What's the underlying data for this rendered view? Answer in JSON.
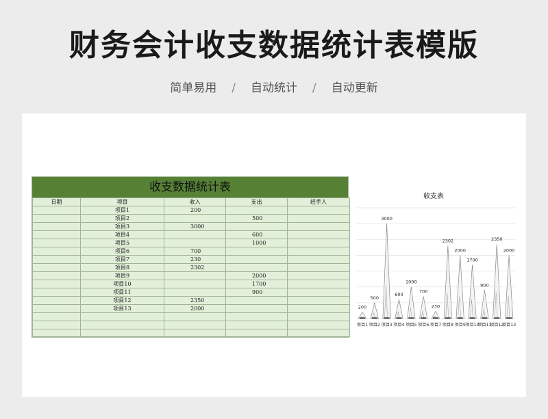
{
  "header": {
    "title": "财务会计收支数据统计表模版",
    "tags": [
      "简单易用",
      "自动统计",
      "自动更新"
    ],
    "separator": "/"
  },
  "sheet": {
    "title": "收支数据统计表",
    "columns": [
      "日期",
      "项目",
      "收入",
      "支出",
      "经手人"
    ],
    "rows": [
      {
        "date": "",
        "item": "项目1",
        "income": "200",
        "expense": "",
        "handler": ""
      },
      {
        "date": "",
        "item": "项目2",
        "income": "",
        "expense": "500",
        "handler": ""
      },
      {
        "date": "",
        "item": "项目3",
        "income": "3000",
        "expense": "",
        "handler": ""
      },
      {
        "date": "",
        "item": "项目4",
        "income": "",
        "expense": "600",
        "handler": ""
      },
      {
        "date": "",
        "item": "项目5",
        "income": "",
        "expense": "1000",
        "handler": ""
      },
      {
        "date": "",
        "item": "项目6",
        "income": "700",
        "expense": "",
        "handler": ""
      },
      {
        "date": "",
        "item": "项目7",
        "income": "230",
        "expense": "",
        "handler": ""
      },
      {
        "date": "",
        "item": "项目8",
        "income": "2302",
        "expense": "",
        "handler": ""
      },
      {
        "date": "",
        "item": "项目9",
        "income": "",
        "expense": "2000",
        "handler": ""
      },
      {
        "date": "",
        "item": "项目10",
        "income": "",
        "expense": "1700",
        "handler": ""
      },
      {
        "date": "",
        "item": "项目11",
        "income": "",
        "expense": "900",
        "handler": ""
      },
      {
        "date": "",
        "item": "项目12",
        "income": "2350",
        "expense": "",
        "handler": ""
      },
      {
        "date": "",
        "item": "项目13",
        "income": "2000",
        "expense": "",
        "handler": ""
      },
      {
        "date": "",
        "item": "",
        "income": "",
        "expense": "",
        "handler": ""
      },
      {
        "date": "",
        "item": "",
        "income": "",
        "expense": "",
        "handler": ""
      },
      {
        "date": "",
        "item": "",
        "income": "",
        "expense": "",
        "handler": ""
      }
    ],
    "colors": {
      "title_bg": "#568135",
      "cell_bg": "#e2efd9",
      "border": "#9fb594"
    }
  },
  "chart_data": {
    "type": "area",
    "title": "收支表",
    "categories": [
      "项目1",
      "项目2",
      "项目3",
      "项目4",
      "项目5",
      "项目6",
      "项目7",
      "项目8",
      "项目9",
      "项目10",
      "项目11",
      "项目12",
      "项目13"
    ],
    "series": [
      {
        "values": [
          200,
          null,
          3000,
          null,
          null,
          700,
          230,
          2302,
          null,
          null,
          null,
          2350,
          2000
        ]
      },
      {
        "values": [
          null,
          500,
          null,
          600,
          1000,
          null,
          null,
          null,
          2000,
          1700,
          900,
          null,
          null
        ]
      }
    ],
    "data_labels": [
      200,
      500,
      3000,
      600,
      1000,
      700,
      230,
      2302,
      2000,
      1700,
      900,
      2350,
      2000
    ],
    "ylim": [
      0,
      3500
    ],
    "grid": true,
    "legend": "none",
    "mark_style": "triangle-spike"
  }
}
